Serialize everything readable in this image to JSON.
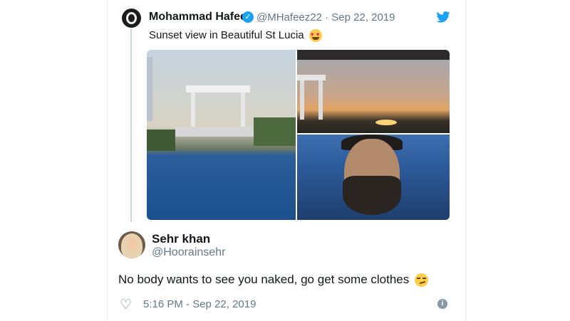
{
  "original_tweet": {
    "author_name": "Mohammad Hafeez",
    "handle": "@MHafeez22",
    "date": "Sep 22, 2019",
    "text": "Sunset view in Beautiful St Lucia",
    "emoji": "heart-eyes-emoji",
    "verified_icon": "verified-badge-icon",
    "platform_icon": "twitter-bird-icon",
    "media_count": 3
  },
  "reply": {
    "author_name": "Sehr khan",
    "handle": "@Hoorainsehr",
    "text": "No body wants to see you naked, go get some clothes",
    "emoji": "smirk-emoji",
    "timestamp": "5:16 PM - Sep 22, 2019",
    "like_icon": "heart-outline-icon",
    "info_icon": "info-icon"
  },
  "colors": {
    "accent": "#1da1f2",
    "secondary_text": "#657786",
    "primary_text": "#14171a",
    "thread_line": "#ccd6dd"
  }
}
